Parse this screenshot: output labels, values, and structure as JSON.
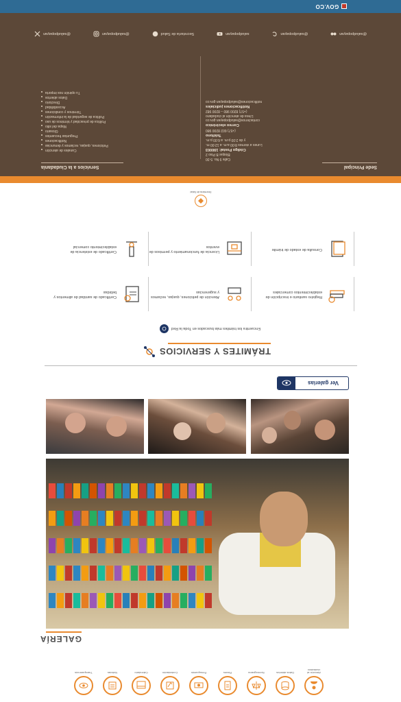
{
  "topbar": {
    "brand": "GOV.CO"
  },
  "icon_strip": [
    {
      "label": "Atención al ciudadano",
      "icon": "person-icon"
    },
    {
      "label": "Datos abiertos",
      "icon": "database-icon"
    },
    {
      "label": "Normograma",
      "icon": "scale-icon"
    },
    {
      "label": "Planes",
      "icon": "document-icon"
    },
    {
      "label": "Presupuesto",
      "icon": "money-icon"
    },
    {
      "label": "Contratación",
      "icon": "contract-icon"
    },
    {
      "label": "Calendario",
      "icon": "calendar-icon"
    },
    {
      "label": "Noticias",
      "icon": "news-icon"
    },
    {
      "label": "Transparencia",
      "icon": "eye-icon"
    }
  ],
  "gallery": {
    "title": "GALERÍA",
    "button_label": "Ver galerías"
  },
  "tramites": {
    "title": "TRÁMITES Y SERVICIOS",
    "subtitle": "Encuentra los trámites más buscados en Toda la Red",
    "items": [
      {
        "text": "Registro sanitario e inscripción de establecimientos comerciales",
        "icon": "books-icon"
      },
      {
        "text": "Atención de peticiones, quejas, reclamos y sugerencias",
        "icon": "people-icon"
      },
      {
        "text": "Certificado de sanidad de alimentos y bebidas",
        "icon": "certificate-icon"
      },
      {
        "text": "Consulta de estado de trámite",
        "icon": "document-icon"
      },
      {
        "text": "Licencia de funcionamiento y permisos de eventos",
        "icon": "calendar-icon"
      },
      {
        "text": "Certificado de existencia de establecimiento comercial",
        "icon": "microscope-icon"
      }
    ]
  },
  "badge": {
    "label": "Secretaría de Salud"
  },
  "footer": {
    "sede_heading": "Sede Principal",
    "sede_lines": [
      {
        "type": "ln",
        "text": "Calle 9 No. 5-30"
      },
      {
        "type": "ln",
        "text": "Bloque B Piso 2"
      },
      {
        "type": "hd",
        "text": "Código Postal: 190003"
      },
      {
        "type": "ln",
        "text": "Lunes a viernes 8:00 a.m. a 12:00 m."
      },
      {
        "type": "ln",
        "text": "y de 2:00 p.m. a 6:00 p.m."
      },
      {
        "type": "hd",
        "text": "Teléfono"
      },
      {
        "type": "ln",
        "text": "(+57) 602 8200 980"
      },
      {
        "type": "hd",
        "text": "Correo electrónico"
      },
      {
        "type": "ln",
        "text": "contactenos@saludpopayan.gov.co"
      },
      {
        "type": "ln",
        "text": "Línea de atención al ciudadano"
      },
      {
        "type": "ln",
        "text": "(+57) 8200 980 – 8200 982"
      },
      {
        "type": "hd",
        "text": "Notificaciones judiciales"
      },
      {
        "type": "ln",
        "text": "notificaciones@saludpopayan.gov.co"
      }
    ],
    "servicios_heading": "Servicios a la Ciudadanía",
    "servicios_items": [
      "Canales de atención",
      "Peticiones, quejas, reclamos y denuncias",
      "Notificaciones",
      "Preguntas frecuentes",
      "Glosario",
      "Mapa del sitio",
      "Política de privacidad y términos de uso",
      "Política de seguridad de la información",
      "Términos y condiciones",
      "Accesibilidad",
      "Directorio",
      "Datos abiertos",
      "Tu opinión nos importa"
    ],
    "social": [
      {
        "label": "@saludpopayan",
        "icon": "x-icon"
      },
      {
        "label": "@saludpopayan",
        "icon": "instagram-icon"
      },
      {
        "label": "Secretaría de Salud",
        "icon": "facebook-icon"
      },
      {
        "label": "saludpopayan",
        "icon": "youtube-icon"
      },
      {
        "label": "@saludpopayan",
        "icon": "threads-icon"
      },
      {
        "label": "@saludpopayan",
        "icon": "flickr-icon"
      }
    ]
  },
  "colors": {
    "accent": "#e98a2e",
    "footer_bg": "#5c4838",
    "top_bar": "#2f6b94",
    "navy": "#1e3564"
  }
}
